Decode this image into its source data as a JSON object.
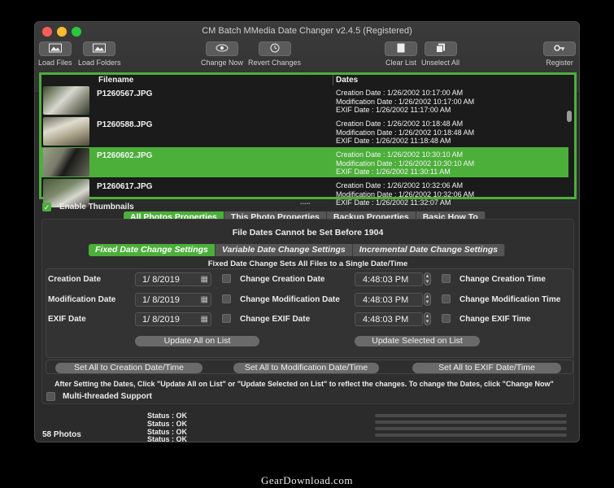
{
  "window": {
    "title": "CM Batch MMedia Date Changer v2.4.5 (Registered)"
  },
  "toolbar": {
    "load_files": "Load Files",
    "load_folders": "Load Folders",
    "change_now": "Change Now",
    "revert_changes": "Revert Changes",
    "clear_list": "Clear List",
    "unselect_all": "Unselect All",
    "register": "Register"
  },
  "list": {
    "col_filename": "Filename",
    "col_dates": "Dates",
    "rows": [
      {
        "name": "P1260567.JPG",
        "d1": "Creation Date : 1/26/2002 10:17:00 AM",
        "d2": "Modification Date : 1/26/2002 10:17:00 AM",
        "d3": "EXIF Date : 1/26/2002 11:17:00 AM"
      },
      {
        "name": "P1260588.JPG",
        "d1": "Creation Date : 1/26/2002 10:18:48 AM",
        "d2": "Modification Date : 1/26/2002 10:18:48 AM",
        "d3": "EXIF Date : 1/26/2002 11:18:48 AM"
      },
      {
        "name": "P1260602.JPG",
        "d1": "Creation Date : 1/26/2002 10:30:10 AM",
        "d2": "Modification Date : 1/26/2002 10:30:10 AM",
        "d3": "EXIF Date : 1/26/2002 11:30:11 AM"
      },
      {
        "name": "P1260617.JPG",
        "d1": "Creation Date : 1/26/2002 10:32:06 AM",
        "d2": "Modification Date : 1/26/2002 10:32:06 AM",
        "d3": "EXIF Date : 1/26/2002 11:32:07 AM"
      }
    ]
  },
  "enable_thumbnails": "Enable Thumbnails",
  "splitter_dots": ".....",
  "main_tabs": [
    "All Photos Properties",
    "This Photo Properties",
    "Backup Properties",
    "Basic How To"
  ],
  "notice": "File Dates Cannot be Set Before 1904",
  "sub_tabs": [
    "Fixed Date Change Settings",
    "Variable Date Change Settings",
    "Incremental Date Change Settings"
  ],
  "sub_caption": "Fixed Date Change Sets All Files to a Single Date/Time",
  "fields": {
    "creation_label": "Creation Date",
    "modification_label": "Modification Date",
    "exif_label": "EXIF Date",
    "creation_date": "1/  8/2019",
    "modification_date": "1/  8/2019",
    "exif_date": "1/  8/2019",
    "change_creation_date": "Change Creation Date",
    "change_modification_date": "Change Modification Date",
    "change_exif_date": "Change EXIF Date",
    "creation_time": "4:48:03 PM",
    "modification_time": "4:48:03 PM",
    "exif_time": "4:48:03 PM",
    "change_creation_time": "Change Creation Time",
    "change_modification_time": "Change Modification Time",
    "change_exif_time": "Change EXIF Time"
  },
  "buttons": {
    "update_all": "Update All on List",
    "update_selected": "Update Selected on List",
    "set_creation": "Set All to Creation Date/Time",
    "set_modification": "Set All to Modification Date/Time",
    "set_exif": "Set All to EXIF Date/Time"
  },
  "instructions": "After Setting the Dates, Click \"Update All on List\" or \"Update Selected on List\" to reflect the changes. To change the Dates, click \"Change Now\"",
  "multithreaded": "Multi-threaded Support",
  "status": {
    "count": "58 Photos",
    "lines": [
      "Status : OK",
      "Status : OK",
      "Status : OK",
      "Status : OK"
    ]
  },
  "watermark": "GearDownload.com",
  "colors": {
    "accent": "#4caf3a",
    "window_bg": "#2b2b2b"
  }
}
